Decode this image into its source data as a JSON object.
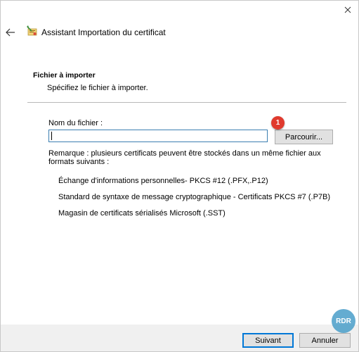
{
  "window": {
    "title": "Assistant Importation du certificat",
    "close_icon": "close-icon",
    "back_icon": "back-arrow-icon",
    "title_icon": "certificate-wizard-icon"
  },
  "section": {
    "title": "Fichier à importer",
    "subtitle": "Spécifiez le fichier à importer."
  },
  "file": {
    "label": "Nom du fichier :",
    "value": "",
    "browse_label": "Parcourir..."
  },
  "annotation": {
    "badge_number": "1",
    "badge_color": "#e03a2e"
  },
  "note": {
    "text": "Remarque : plusieurs certificats peuvent être stockés dans un même fichier aux formats suivants :",
    "formats": [
      "Échange d'informations personnelles- PKCS #12 (.PFX,.P12)",
      "Standard de syntaxe de message cryptographique - Certificats PKCS #7 (.P7B)",
      "Magasin de certificats sérialisés Microsoft (.SST)"
    ]
  },
  "footer": {
    "next_label": "Suivant",
    "cancel_label": "Annuler",
    "accent_color": "#0078d7"
  },
  "watermark": {
    "text": "RDR"
  }
}
